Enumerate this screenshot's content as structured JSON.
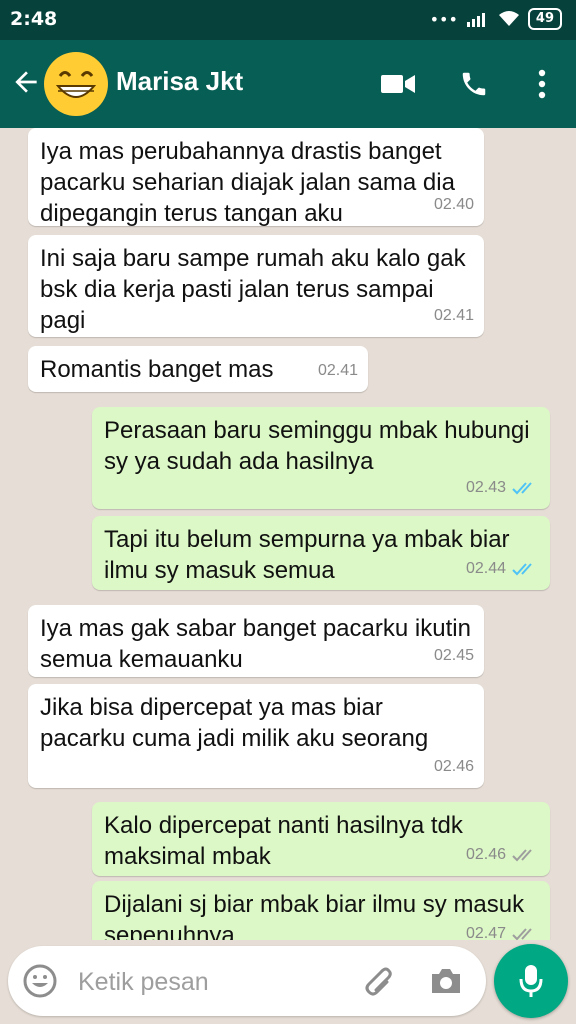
{
  "status_bar": {
    "time": "2:48",
    "battery": "49"
  },
  "header": {
    "contact_name": "Marisa Jkt"
  },
  "messages": [
    {
      "direction": "in",
      "text": "Iya mas perubahannya drastis banget pacarku seharian diajak jalan sama dia dipegangin terus tangan aku",
      "time": "02.40"
    },
    {
      "direction": "in",
      "text": "Ini saja baru sampe rumah aku kalo gak bsk dia kerja pasti jalan terus sampai pagi",
      "time": "02.41"
    },
    {
      "direction": "in",
      "text": "Romantis banget mas",
      "time": "02.41"
    },
    {
      "direction": "out",
      "text": "Perasaan baru seminggu mbak hubungi sy ya sudah ada hasilnya",
      "time": "02.43",
      "status": "read"
    },
    {
      "direction": "out",
      "text": "Tapi itu belum sempurna ya mbak biar ilmu sy masuk semua",
      "time": "02.44",
      "status": "read"
    },
    {
      "direction": "in",
      "text": "Iya mas gak sabar banget pacarku ikutin semua kemauanku",
      "time": "02.45"
    },
    {
      "direction": "in",
      "text": "Jika bisa dipercepat ya mas biar pacarku cuma jadi milik aku seorang",
      "time": "02.46"
    },
    {
      "direction": "out",
      "text": "Kalo dipercepat nanti hasilnya tdk maksimal mbak",
      "time": "02.46",
      "status": "delivered"
    },
    {
      "direction": "out",
      "text": "Dijalani sj biar mbak biar ilmu sy masuk sepenuhnya",
      "time": "02.47",
      "status": "delivered"
    }
  ],
  "composer": {
    "placeholder": "Ketik pesan"
  },
  "colors": {
    "header": "#075e54",
    "status_bar": "#06423b",
    "outgoing_bubble": "#dcf8c6",
    "incoming_bubble": "#ffffff",
    "mic_button": "#00a884",
    "read_ticks": "#4fc3f7"
  },
  "icons": [
    "back-arrow-icon",
    "video-call-icon",
    "phone-icon",
    "more-vert-icon",
    "emoji-icon",
    "attach-icon",
    "camera-icon",
    "mic-icon"
  ]
}
